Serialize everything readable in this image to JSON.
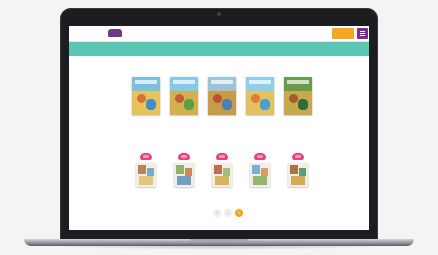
{
  "header": {
    "nav_links": [
      "",
      "",
      "",
      ""
    ],
    "cta_label": "",
    "accent_color": "#f5a623",
    "brand_color": "#7b2c8f"
  },
  "banner": {
    "text": "",
    "color": "#5bc6b4"
  },
  "page": {
    "title": ""
  },
  "books": [
    {
      "caption": "",
      "colors": [
        "#7cc0e0",
        "#e8c35a",
        "#d9703a",
        "#3f8fc4"
      ]
    },
    {
      "caption": "",
      "colors": [
        "#86c9e6",
        "#d4b04d",
        "#c65a3c",
        "#5a9e4a"
      ]
    },
    {
      "caption": "",
      "colors": [
        "#9bc4d8",
        "#c99b44",
        "#b9503a",
        "#4c7fb6"
      ]
    },
    {
      "caption": "",
      "colors": [
        "#90cde9",
        "#e4c160",
        "#e07a3d",
        "#4aa0d0"
      ]
    },
    {
      "caption": "",
      "colors": [
        "#6a9a4c",
        "#c5a94a",
        "#a35a2f",
        "#2f6b3a"
      ]
    }
  ],
  "games": [
    {
      "caption": "",
      "colors": [
        "#b9825a",
        "#7aa9c7",
        "#e3c77a"
      ]
    },
    {
      "caption": "",
      "colors": [
        "#8fb36a",
        "#c98a5a",
        "#6f9fc4"
      ]
    },
    {
      "caption": "",
      "colors": [
        "#c46d4a",
        "#9fc07a",
        "#d8b45e"
      ]
    },
    {
      "caption": "",
      "colors": [
        "#7eaed0",
        "#d1a062",
        "#91b86e"
      ]
    },
    {
      "caption": "",
      "colors": [
        "#a8733f",
        "#5f9b6c",
        "#d5a85a"
      ]
    }
  ],
  "pagination": {
    "pages": [
      "1",
      "2",
      "3"
    ],
    "active_index": 2
  }
}
